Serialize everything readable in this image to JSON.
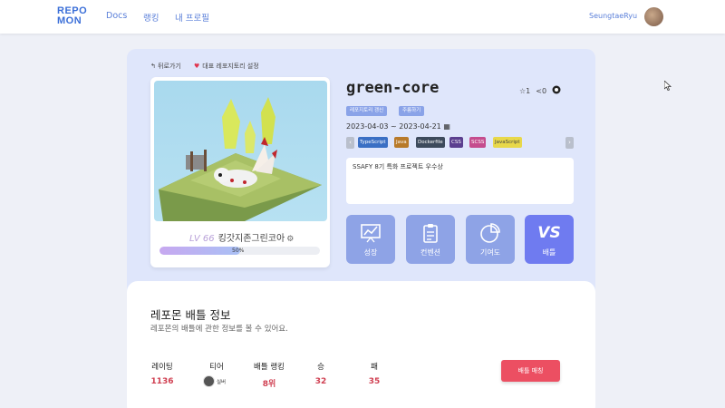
{
  "nav": {
    "logo_line1": "REPO",
    "logo_line2": "MON",
    "links": [
      "Docs",
      "랭킹",
      "내 프로필"
    ],
    "username": "SeungtaeRyu"
  },
  "header": {
    "back_label": "뒤로가기",
    "representative_label": "대표 레포지토리 설정"
  },
  "profile": {
    "level": "LV 66",
    "name": "킹갓지존그린코아",
    "exp_percent": 50,
    "exp_text": "50%"
  },
  "repo": {
    "title": "green-core",
    "star_count": "1",
    "fork_count": "0",
    "buttons": [
      "레포지토리 갱신",
      "주름하기"
    ],
    "date_range": "2023-04-03 ~ 2023-04-21",
    "languages": [
      {
        "name": "TypeScript",
        "color": "#3a6fc4"
      },
      {
        "name": "Java",
        "color": "#b87a2a"
      },
      {
        "name": "Dockerfile",
        "color": "#3d4a5c"
      },
      {
        "name": "CSS",
        "color": "#5b3f8f"
      },
      {
        "name": "SCSS",
        "color": "#c54c8e"
      },
      {
        "name": "JavaScript",
        "color": "#e8d84a"
      }
    ],
    "description": "SSAFY 8기 특화 프로젝트 우수상"
  },
  "actions": [
    {
      "label": "성장",
      "icon": "growth-chart-icon"
    },
    {
      "label": "컨벤션",
      "icon": "clipboard-icon"
    },
    {
      "label": "기여도",
      "icon": "pie-chart-icon"
    },
    {
      "label": "배틀",
      "icon": "vs-icon",
      "text": "VS"
    }
  ],
  "battle": {
    "title": "레포몬 배틀 정보",
    "subtitle": "레포몬의 배틀에 관한 정보를 볼 수 있어요.",
    "stats": {
      "rating_label": "레이팅",
      "rating_value": "1136",
      "tier_label": "티어",
      "tier_value": "실버",
      "rank_label": "배틀 랭킹",
      "rank_value": "8위",
      "win_label": "승",
      "win_value": "32",
      "loss_label": "패",
      "loss_value": "35"
    },
    "match_button": "배틀 매칭"
  },
  "colors": {
    "accent": "#5a7fd9",
    "card_bg": "#dfe6fb",
    "action_button": "#8ea3e6",
    "battle_button": "#6f7bf0",
    "stat_value": "#d04052",
    "match_button": "#ec4f62"
  }
}
